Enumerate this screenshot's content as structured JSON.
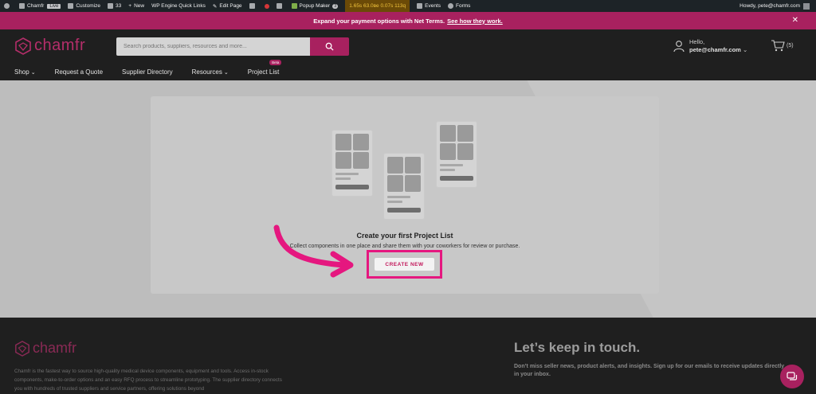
{
  "wp_admin_bar": {
    "site": "Chamfr",
    "live": "Live",
    "customize": "Customize",
    "comments": "33",
    "new": "New",
    "wp_engine": "WP Engine Quick Links",
    "edit_page": "Edit Page",
    "popup_maker": "Popup Maker",
    "popup_count": "3",
    "perf": "1.65s  63.0ве  0.07s  113q",
    "events": "Events",
    "forms": "Forms",
    "howdy": "Howdy, pete@chamfr.com"
  },
  "promo": {
    "text": "Expand your payment options with Net Terms.",
    "link": "See how they work."
  },
  "header": {
    "logo": "chamfr",
    "search_placeholder": "Search products, suppliers, resources and more...",
    "hello": "Hello,",
    "email": "pete@chamfr.com",
    "cart_count": "(5)"
  },
  "nav": {
    "shop": "Shop",
    "quote": "Request a Quote",
    "supplier": "Supplier Directory",
    "resources": "Resources",
    "project_list": "Project List",
    "beta": "Beta"
  },
  "main": {
    "title": "Create your first Project List",
    "subtitle": "Collect components in one place and share them with your coworkers for review or purchase.",
    "create_button": "CREATE NEW"
  },
  "footer": {
    "logo": "chamfr",
    "description": "Chamfr is the fastest way to source high-quality medical device components, equipment and tools. Access in-stock components, make-to-order options and an easy RFQ process to streamline prototyping. The supplier directory connects you with hundreds of trusted suppliers and service partners, offering solutions beyond",
    "heading": "Let’s keep in touch.",
    "subheading": "Don’t miss seller news, product alerts, and insights. Sign up for our emails to receive updates directly in your inbox."
  },
  "colors": {
    "brand": "#a8215f",
    "highlight": "#e5177f",
    "dark": "#1f1f1f"
  }
}
